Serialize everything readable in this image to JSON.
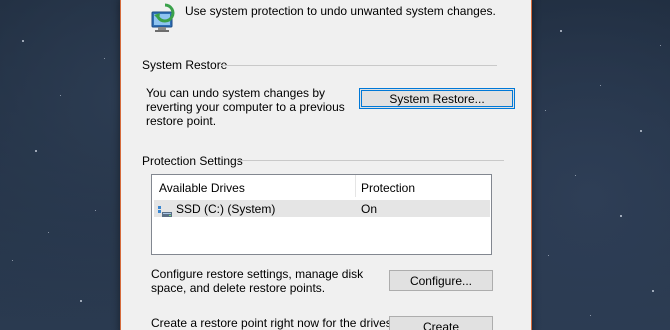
{
  "header": {
    "description": "Use system protection to undo unwanted system changes.",
    "icon": "system-protection-icon"
  },
  "system_restore": {
    "group_label": "System Restore",
    "description": "You can undo system changes by reverting your computer to a previous restore point.",
    "button_label": "System Restore..."
  },
  "protection_settings": {
    "group_label": "Protection Settings",
    "table": {
      "columns": [
        "Available Drives",
        "Protection"
      ],
      "rows": [
        {
          "drive": "SSD (C:) (System)",
          "protection": "On",
          "icon": "drive-icon"
        }
      ]
    },
    "configure": {
      "description": "Configure restore settings, manage disk space, and delete restore points.",
      "button_label": "Configure..."
    },
    "create": {
      "description": "Create a restore point right now for the drives that",
      "button_label": "Create"
    }
  },
  "colors": {
    "dialog_bg": "#f0f0f0",
    "focus_border": "#0078d7",
    "window_border": "#d66b3c"
  }
}
